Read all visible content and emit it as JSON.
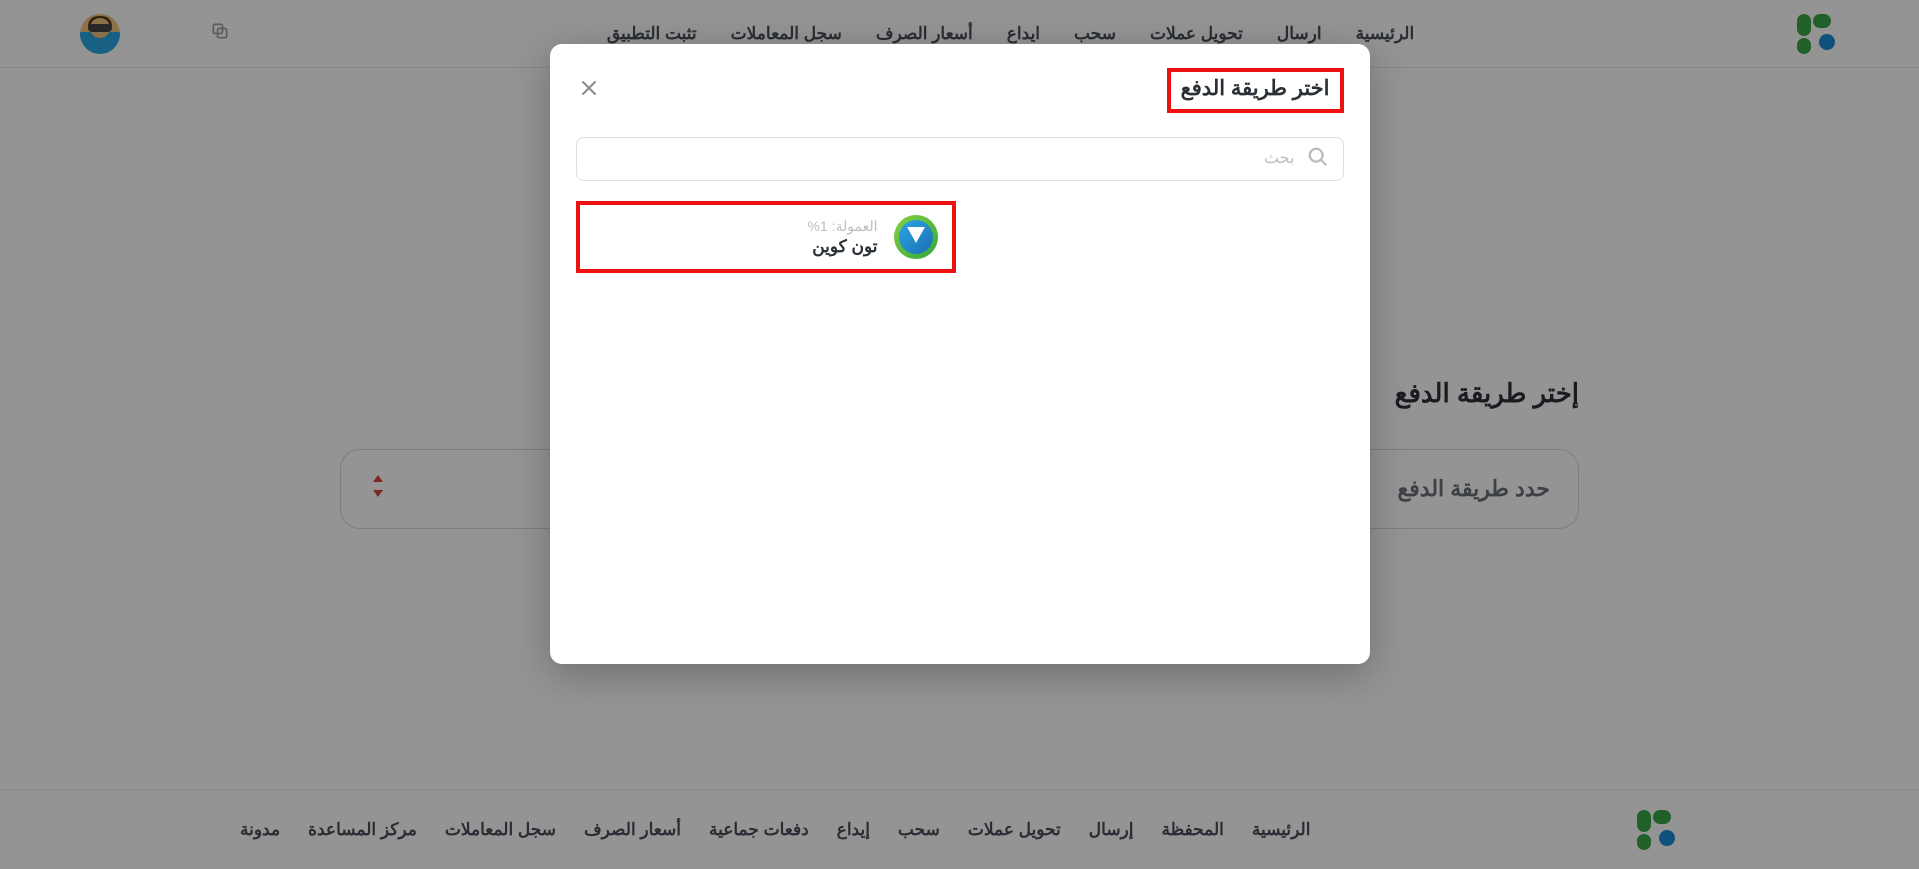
{
  "header": {
    "nav": [
      "الرئيسية",
      "ارسال",
      "تحويل عملات",
      "سحب",
      "ايداع",
      "أسعار الصرف",
      "سجل المعاملات",
      "تثبت التطبيق"
    ]
  },
  "page": {
    "heading": "إختر طريقة الدفع",
    "select_placeholder": "حدد طريقة الدفع"
  },
  "footer": {
    "nav": [
      "الرئيسية",
      "المحفظة",
      "إرسال",
      "تحويل عملات",
      "سحب",
      "إيداع",
      "دفعات جماعية",
      "أسعار الصرف",
      "سجل المعاملات",
      "مركز المساعدة",
      "مدونة"
    ]
  },
  "modal": {
    "title": "اختر طريقة الدفع",
    "search_placeholder": "بحث",
    "option": {
      "commission_label": "العمولة: 1%",
      "name": "تون كوين"
    }
  }
}
